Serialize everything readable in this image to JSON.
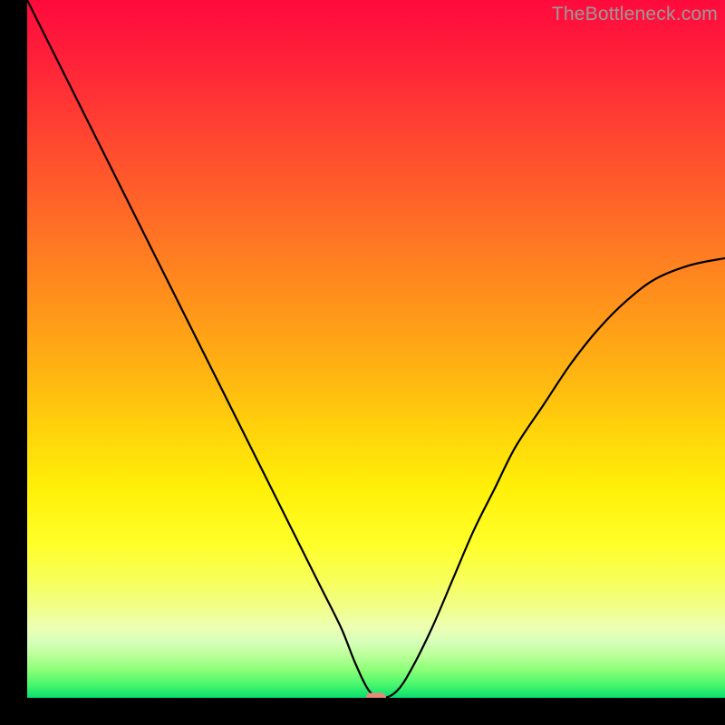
{
  "watermark": {
    "text": "TheBottleneck.com"
  },
  "colors": {
    "gradient_top": "#ff0a3c",
    "gradient_mid": "#ffd80a",
    "gradient_bottom": "#08df6f",
    "curve": "#000000",
    "marker": "#e78a78",
    "frame": "#000000"
  },
  "chart_data": {
    "type": "line",
    "title": "",
    "xlabel": "",
    "ylabel": "",
    "xlim": [
      0,
      100
    ],
    "ylim": [
      0,
      100
    ],
    "annotations": [
      {
        "name": "optimal-marker",
        "x": 50,
        "y": 0
      }
    ],
    "series": [
      {
        "name": "bottleneck-curve",
        "x": [
          0,
          3,
          6,
          9,
          12,
          15,
          18,
          21,
          24,
          27,
          30,
          33,
          36,
          39,
          42,
          45,
          47,
          49,
          51,
          53,
          55,
          58,
          61,
          64,
          67,
          70,
          74,
          78,
          82,
          86,
          90,
          95,
          100
        ],
        "y": [
          100,
          94,
          88,
          82,
          76,
          70,
          64,
          58,
          52,
          46,
          40,
          34,
          28,
          22,
          16,
          10,
          5,
          1,
          0,
          1,
          4,
          10,
          17,
          24,
          30,
          36,
          42,
          48,
          53,
          57,
          60,
          62,
          63
        ]
      }
    ]
  }
}
